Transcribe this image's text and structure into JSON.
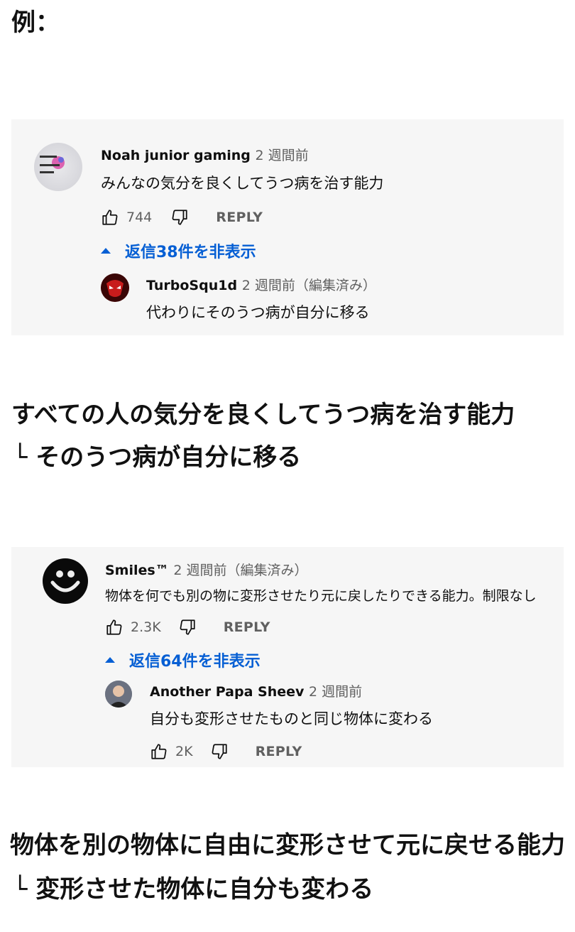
{
  "heading": "例：",
  "example1": {
    "comment": {
      "author": "Noah junior gaming",
      "time": "2 週間前",
      "text": "みんなの気分を良くしてうつ病を治す能力",
      "likes": "744",
      "reply_label": "REPLY",
      "avatar_text": "Noah junior Gaming"
    },
    "toggle_label": "返信38件を非表示",
    "reply": {
      "author": "TurboSqu1d",
      "time": "2 週間前（編集済み）",
      "text": "代わりにそのうつ病が自分に移る"
    },
    "summary_main": "すべての人の気分を良くしてうつ病を治す能力",
    "summary_sub": "└ そのうつ病が自分に移る"
  },
  "example2": {
    "comment": {
      "author": "Smiles™",
      "time": "2 週間前（編集済み）",
      "text": "物体を何でも別の物に変形させたり元に戻したりできる能力。制限なし",
      "likes": "2.3K",
      "reply_label": "REPLY"
    },
    "toggle_label": "返信64件を非表示",
    "reply": {
      "author": "Another Papa Sheev",
      "time": "2 週間前",
      "text": "自分も変形させたものと同じ物体に変わる",
      "likes": "2K",
      "reply_label": "REPLY"
    },
    "summary_main": "物体を別の物体に自由に変形させて元に戻せる能力",
    "summary_sub": "└ 変形させた物体に自分も変わる"
  },
  "colors": {
    "link_blue": "#065fd4",
    "panel_bg": "#f6f6f6",
    "meta_gray": "#606060"
  },
  "icons": [
    "thumb-up-icon",
    "thumb-down-icon",
    "caret-up-icon"
  ]
}
